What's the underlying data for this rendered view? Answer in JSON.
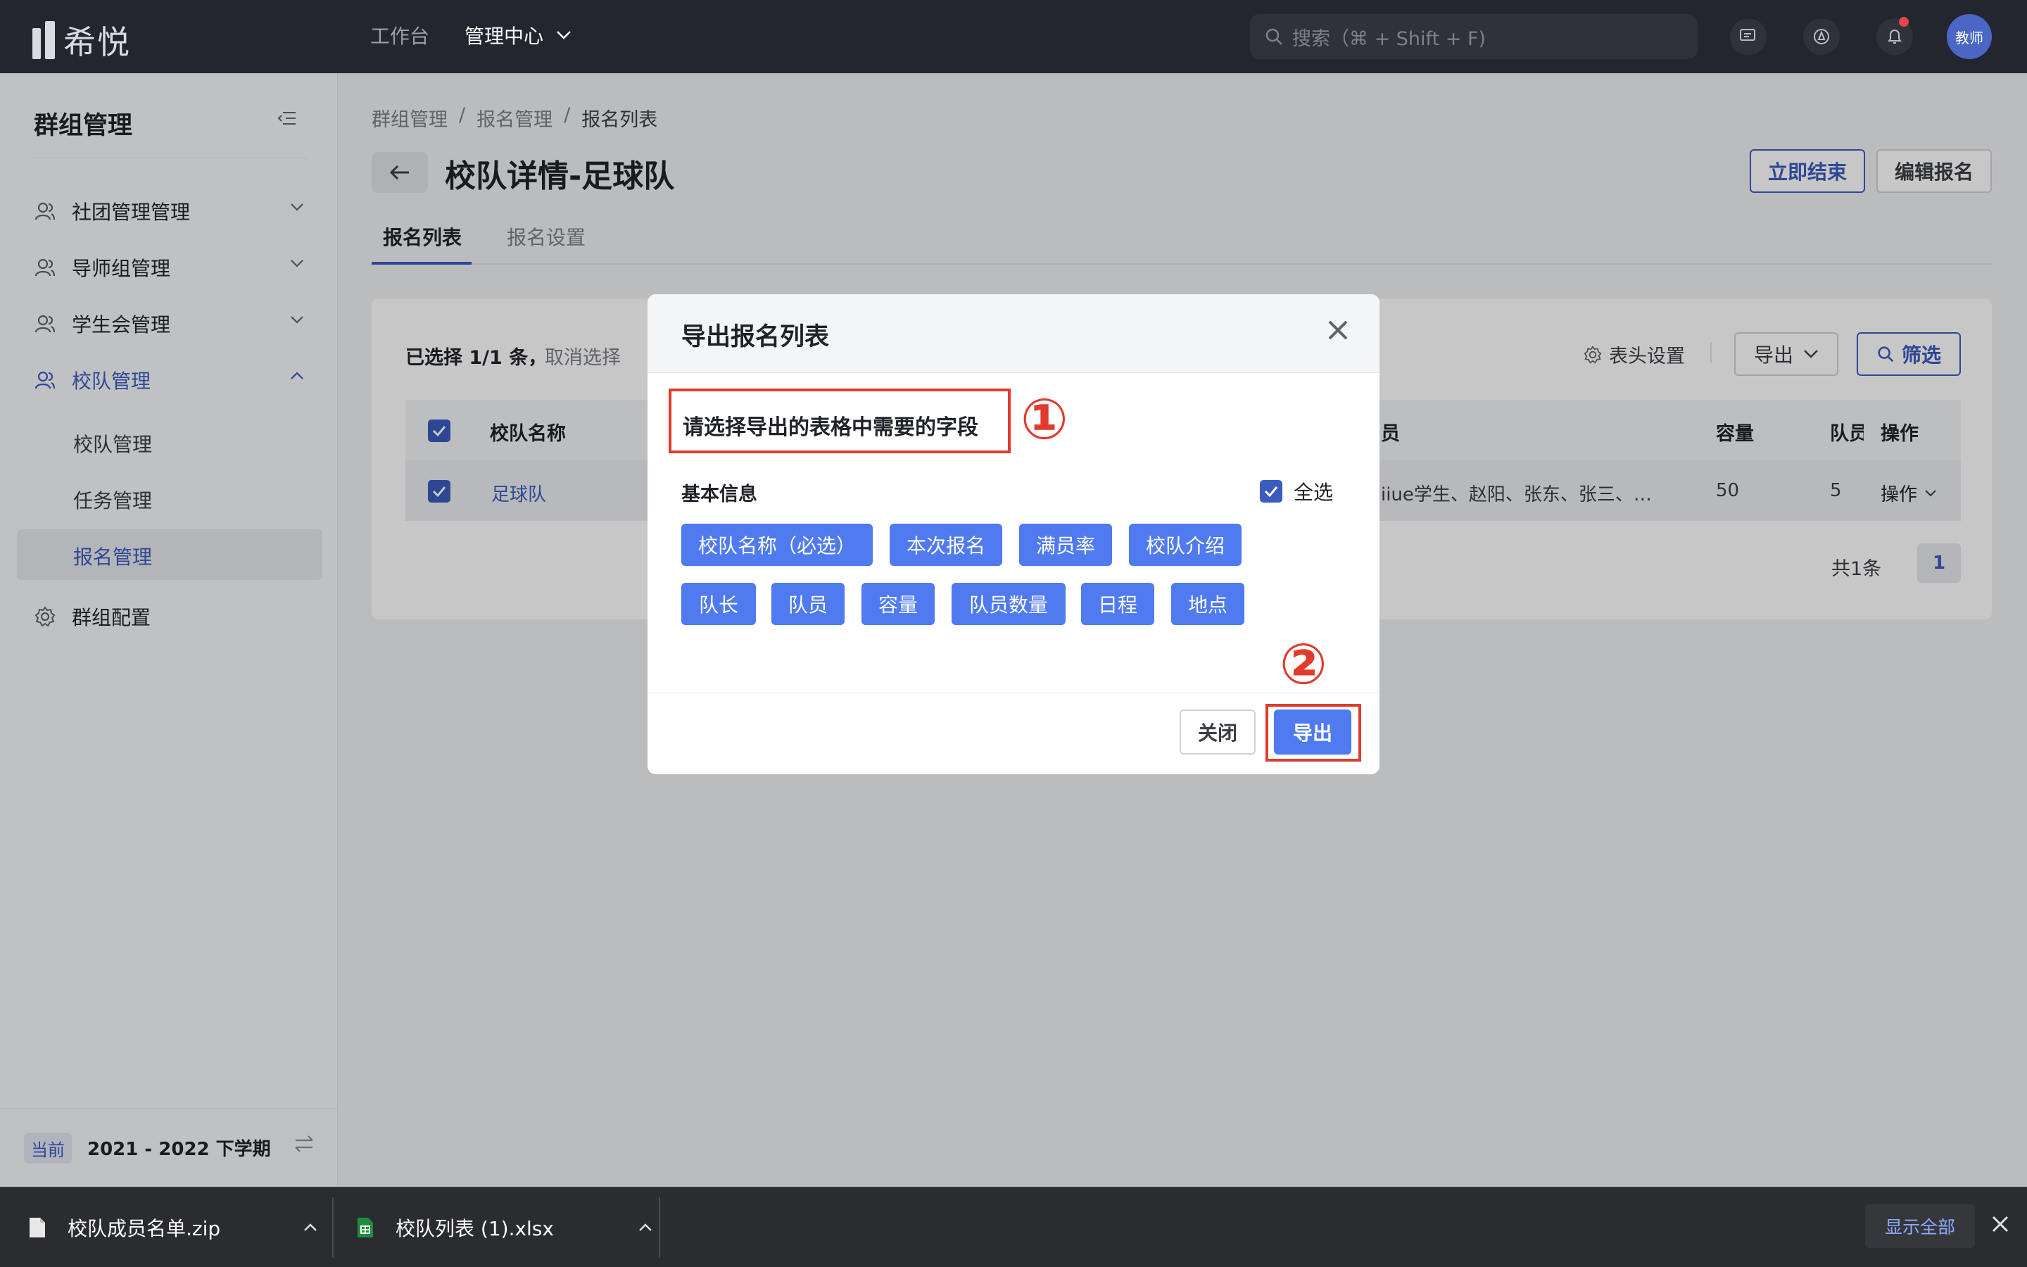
{
  "topbar": {
    "logo_text": "希悦",
    "nav": [
      "工作台",
      "管理中心"
    ],
    "search_placeholder": "搜索（⌘ + Shift + F)",
    "avatar_label": "教师",
    "colors": {
      "bg": "#23262e",
      "notification_dot": "#e24646"
    }
  },
  "sidebar": {
    "title": "群组管理",
    "items": [
      {
        "label": "社团管理管理"
      },
      {
        "label": "导师组管理"
      },
      {
        "label": "学生会管理"
      },
      {
        "label": "校队管理"
      },
      {
        "label": "群组配置"
      }
    ],
    "subitems": [
      {
        "label": "校队管理"
      },
      {
        "label": "任务管理"
      },
      {
        "label": "报名管理"
      }
    ],
    "term_tag": "当前",
    "term_text": "2021 - 2022 下学期"
  },
  "breadcrumb": [
    "群组管理",
    "/",
    "报名管理",
    "/",
    "报名列表"
  ],
  "page": {
    "title": "校队详情-足球队",
    "end_button": "立即结束",
    "edit_button": "编辑报名",
    "tabs": [
      "报名列表",
      "报名设置"
    ]
  },
  "toolbar": {
    "selected": "已选择 1/1 条，",
    "cancel_select": "取消选择",
    "column_settings": "表头设置",
    "export": "导出",
    "filter": "筛选"
  },
  "table": {
    "headers": [
      "校队名称",
      "员",
      "容量",
      "队员",
      "操作"
    ],
    "rows": [
      {
        "name": "足球队",
        "members": "iiue学生、赵阳、张东、张三、…",
        "capacity": "50",
        "count": "5",
        "action": "操作"
      }
    ],
    "total": "共1条",
    "page": "1"
  },
  "modal": {
    "title": "导出报名列表",
    "hint": "请选择导出的表格中需要的字段",
    "step1": "①",
    "step2": "②",
    "section": "基本信息",
    "select_all": "全选",
    "chips_row1": [
      "校队名称（必选）",
      "本次报名",
      "满员率",
      "校队介绍"
    ],
    "chips_row2": [
      "队长",
      "队员",
      "容量",
      "队员数量",
      "日程",
      "地点"
    ],
    "close_button": "关闭",
    "export_button": "导出",
    "colors": {
      "annotation": "#e03b2c",
      "chip": "#4f7af0"
    }
  },
  "downloads": {
    "items": [
      "校队成员名单.zip",
      "校队列表 (1).xlsx"
    ],
    "show_all": "显示全部"
  },
  "colors": {
    "accent": "#3b5bbf"
  }
}
